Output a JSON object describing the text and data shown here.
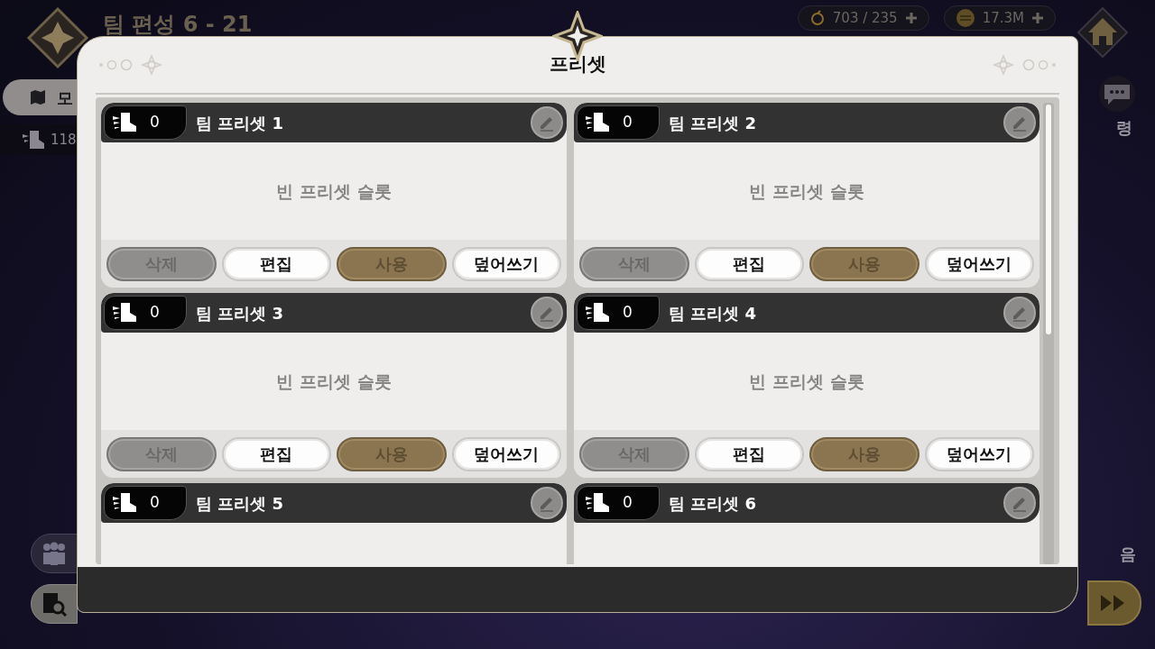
{
  "background": {
    "title": "팀 편성 6 - 21",
    "resources": [
      {
        "kind": "stamina",
        "value": "703 / 235"
      },
      {
        "kind": "coin",
        "value": "17.3M"
      }
    ],
    "left_labels": [
      "모",
      "118"
    ],
    "right_labels": [
      "령",
      "음"
    ]
  },
  "dialog": {
    "title": "프리셋",
    "presets": [
      {
        "count": "0",
        "name": "팀 프리셋 1",
        "empty_text": "빈 프리셋 슬롯",
        "buttons": [
          {
            "label": "삭제",
            "kind": "grey"
          },
          {
            "label": "편집",
            "kind": "white"
          },
          {
            "label": "사용",
            "kind": "gold"
          },
          {
            "label": "덮어쓰기",
            "kind": "white"
          }
        ]
      },
      {
        "count": "0",
        "name": "팀 프리셋 2",
        "empty_text": "빈 프리셋 슬롯",
        "buttons": [
          {
            "label": "삭제",
            "kind": "grey"
          },
          {
            "label": "편집",
            "kind": "white"
          },
          {
            "label": "사용",
            "kind": "gold"
          },
          {
            "label": "덮어쓰기",
            "kind": "white"
          }
        ]
      },
      {
        "count": "0",
        "name": "팀 프리셋 3",
        "empty_text": "빈 프리셋 슬롯",
        "buttons": [
          {
            "label": "삭제",
            "kind": "grey"
          },
          {
            "label": "편집",
            "kind": "white"
          },
          {
            "label": "사용",
            "kind": "gold"
          },
          {
            "label": "덮어쓰기",
            "kind": "white"
          }
        ]
      },
      {
        "count": "0",
        "name": "팀 프리셋 4",
        "empty_text": "빈 프리셋 슬롯",
        "buttons": [
          {
            "label": "삭제",
            "kind": "grey"
          },
          {
            "label": "편집",
            "kind": "white"
          },
          {
            "label": "사용",
            "kind": "gold"
          },
          {
            "label": "덮어쓰기",
            "kind": "white"
          }
        ]
      },
      {
        "count": "0",
        "name": "팀 프리셋 5"
      },
      {
        "count": "0",
        "name": "팀 프리셋 6"
      }
    ]
  }
}
